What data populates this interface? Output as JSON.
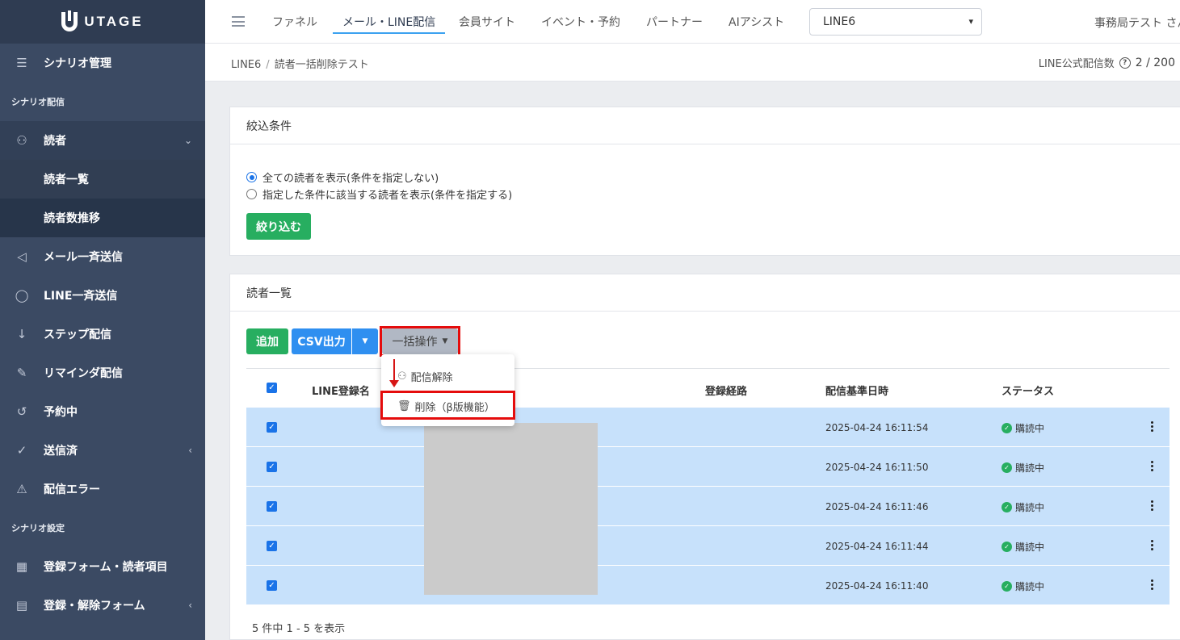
{
  "app": {
    "logo_text": "UTAGE"
  },
  "sidebar": {
    "scenario_mgmt": "シナリオ管理",
    "section_delivery": "シナリオ配信",
    "readers": "読者",
    "reader_list": "読者一覧",
    "reader_trend": "読者数推移",
    "mail_broadcast": "メール一斉送信",
    "line_broadcast": "LINE一斉送信",
    "step_delivery": "ステップ配信",
    "reminder": "リマインダ配信",
    "scheduled": "予約中",
    "sent": "送信済",
    "delivery_error": "配信エラー",
    "section_settings": "シナリオ設定",
    "reg_form": "登録フォーム・読者項目",
    "reg_cancel_form": "登録・解除フォーム"
  },
  "topnav": {
    "funnel": "ファネル",
    "mail_line": "メール・LINE配信",
    "member_site": "会員サイト",
    "event": "イベント・予約",
    "partner": "パートナー",
    "ai_assist": "AIアシスト",
    "account_select": "LINE6",
    "user_name": "事務局テスト さん"
  },
  "breadcrumb": {
    "account": "LINE6",
    "sep": "/",
    "page": "読者一括削除テスト"
  },
  "quota": {
    "label": "LINE公式配信数",
    "help": "?",
    "value": "2 / 200"
  },
  "filter": {
    "title": "絞込条件",
    "option_all": "全ての読者を表示(条件を指定しない)",
    "option_cond": "指定した条件に該当する読者を表示(条件を指定する)",
    "apply_button": "絞り込む"
  },
  "reader_list": {
    "title": "読者一覧",
    "add_button": "追加",
    "csv_button": "CSV出力",
    "bulk_button": "一括操作",
    "dropdown": {
      "unsubscribe": "配信解除",
      "delete": "削除（β版機能）"
    },
    "columns": {
      "name": "LINE登録名",
      "route": "登録経路",
      "date": "配信基準日時",
      "status": "ステータス"
    },
    "rows": [
      {
        "date": "2025-04-24 16:11:54",
        "status": "購読中"
      },
      {
        "date": "2025-04-24 16:11:50",
        "status": "購読中"
      },
      {
        "date": "2025-04-24 16:11:46",
        "status": "購読中"
      },
      {
        "date": "2025-04-24 16:11:44",
        "status": "購読中"
      },
      {
        "date": "2025-04-24 16:11:40",
        "status": "購読中"
      }
    ],
    "count_text": "5 件中 1 - 5 を表示"
  },
  "colors": {
    "sidebar": "#3b4a63",
    "accent_blue": "#2f8ff0",
    "green": "#27ae60",
    "highlight_red": "#e50c0c",
    "row_selected": "#c7e1fb"
  }
}
